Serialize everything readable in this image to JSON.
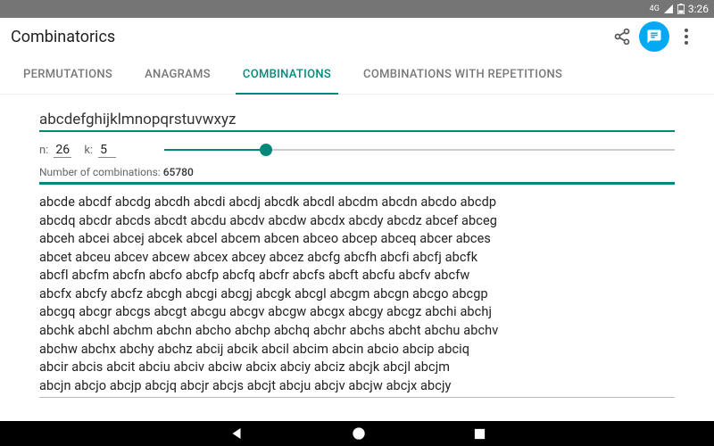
{
  "status": {
    "net": "4G",
    "time": "3:26"
  },
  "appbar": {
    "title": "Combinatorics"
  },
  "tabs": {
    "perm": "PERMUTATIONS",
    "anag": "ANAGRAMS",
    "comb": "COMBINATIONS",
    "combrep": "COMBINATIONS WITH REPETITIONS"
  },
  "input": {
    "value": "abcdefghijklmnopqrstuvwxyz"
  },
  "params": {
    "n_label": "n:",
    "n": "26",
    "k_label": "k:",
    "k": "5",
    "slider_pct": 20
  },
  "count": {
    "label": "Number of combinations:",
    "value": "65780"
  },
  "results_lines": [
    "abcde abcdf abcdg abcdh abcdi abcdj abcdk abcdl abcdm abcdn abcdo abcdp",
    "abcdq abcdr abcds abcdt abcdu abcdv abcdw abcdx abcdy abcdz abcef abceg",
    "abceh abcei abcej abcek abcel abcem abcen abceo abcep abceq abcer abces",
    "abcet abceu abcev abcew abcex abcey abcez abcfg abcfh abcfi abcfj abcfk",
    "abcfl abcfm abcfn abcfo abcfp abcfq abcfr abcfs abcft abcfu abcfv abcfw",
    "abcfx abcfy abcfz abcgh abcgi abcgj abcgk abcgl abcgm abcgn abcgo abcgp",
    "abcgq abcgr abcgs abcgt abcgu abcgv abcgw abcgx abcgy abcgz abchi abchj",
    "abchk abchl abchm abchn abcho abchp abchq abchr abchs abcht abchu abchv",
    "abchw abchx abchy abchz abcij abcik abcil abcim abcin abcio abcip abciq",
    "abcir abcis abcit abciu abciv abciw abcix abciy abciz abcjk abcjl abcjm",
    "abcjn abcjo abcjp abcjq abcjr abcjs abcjt abcju abcjv abcjw abcjx abcjy"
  ]
}
